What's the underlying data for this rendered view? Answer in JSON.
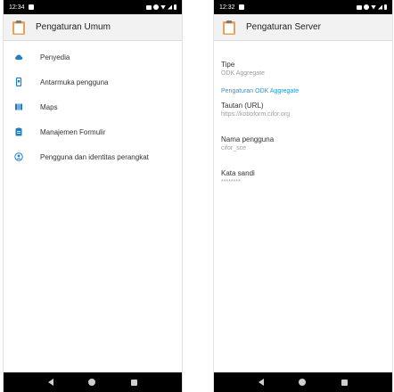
{
  "left_screen": {
    "status_time": "12:34",
    "title": "Pengaturan Umum",
    "items": [
      {
        "label": "Penyedia",
        "icon": "cloud-icon"
      },
      {
        "label": "Antarmuka pengguna",
        "icon": "phone-icon"
      },
      {
        "label": "Maps",
        "icon": "map-icon"
      },
      {
        "label": "Manajemen Formulir",
        "icon": "clipboard-list-icon"
      },
      {
        "label": "Pengguna dan identitas perangkat",
        "icon": "user-id-icon"
      }
    ]
  },
  "right_screen": {
    "status_time": "12:32",
    "title": "Pengaturan Server",
    "type_title": "Tipe",
    "type_value": "ODK Aggregate",
    "section_header": "Pengaturan ODK Aggregate",
    "url_title": "Tautan (URL)",
    "url_value": "https://koboform.cifor.org",
    "username_title": "Nama pengguna",
    "username_value": "cifor_sce",
    "password_title": "Kata sandi",
    "password_value": "********"
  },
  "colors": {
    "icon_blue": "#1f7fc4",
    "accent": "#2a97d4",
    "clipboard_board": "#e2a25b"
  }
}
